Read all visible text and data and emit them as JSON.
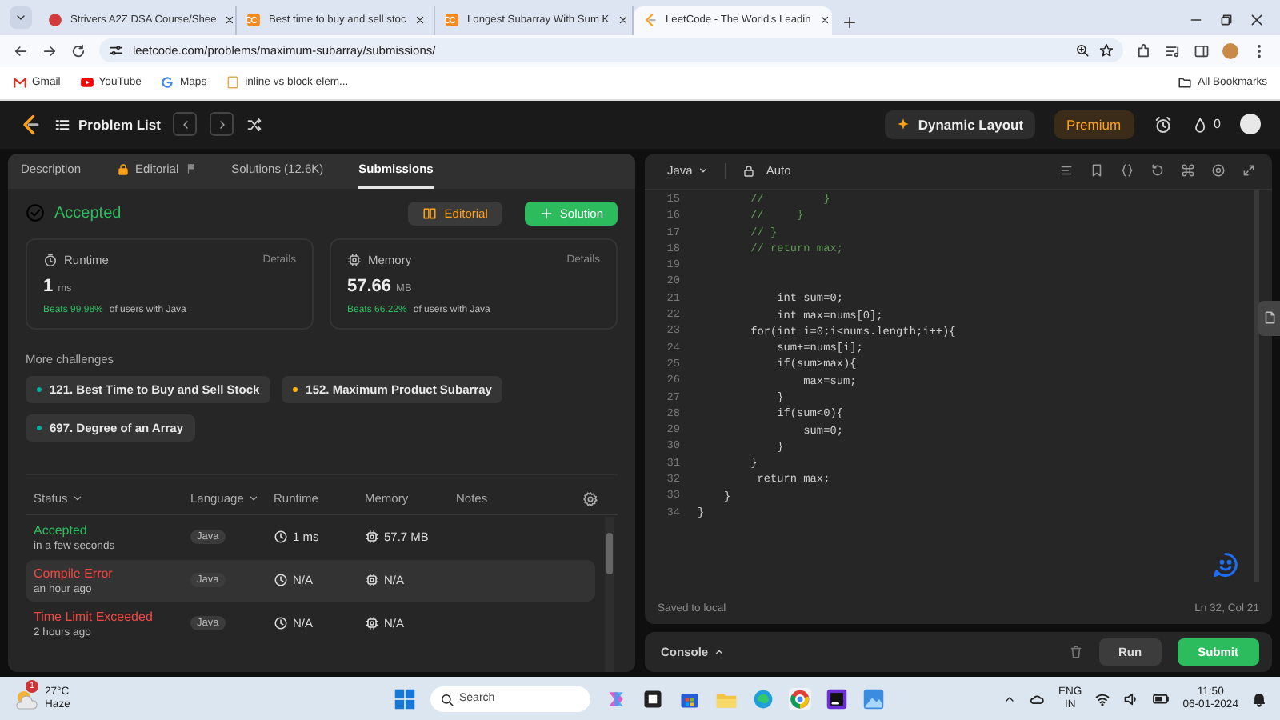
{
  "browser": {
    "tabs": [
      {
        "title": "Strivers A2Z DSA Course/Shee",
        "kind": "tuf",
        "selected": false
      },
      {
        "title": "Best time to buy and sell stoc",
        "kind": "ninjas",
        "selected": false
      },
      {
        "title": "Longest Subarray With Sum K",
        "kind": "ninjas",
        "selected": false
      },
      {
        "title": "LeetCode - The World's Leadin",
        "kind": "leetcode",
        "selected": true
      }
    ],
    "address": "leetcode.com/problems/maximum-subarray/submissions/",
    "bookmarks": [
      {
        "label": "Gmail",
        "kind": "gmail"
      },
      {
        "label": "YouTube",
        "kind": "youtube"
      },
      {
        "label": "Maps",
        "kind": "maps"
      },
      {
        "label": "inline vs block elem...",
        "kind": "page"
      }
    ],
    "all_bookmarks": "All Bookmarks"
  },
  "nav": {
    "problem_list": "Problem List",
    "dynamic_layout": "Dynamic Layout",
    "premium": "Premium",
    "streak": "0"
  },
  "left": {
    "tabs": [
      {
        "label": "Description",
        "selected": false,
        "locked": false
      },
      {
        "label": "Editorial",
        "selected": false,
        "locked": true
      },
      {
        "label": "Solutions (12.6K)",
        "selected": false,
        "locked": false
      },
      {
        "label": "Submissions",
        "selected": true,
        "locked": false
      }
    ],
    "result": {
      "status": "Accepted",
      "editorial_button": "Editorial",
      "solution_button": "Solution"
    },
    "metrics": [
      {
        "label": "Runtime",
        "kind": "runtime",
        "details": "Details",
        "value": "1",
        "unit": "ms",
        "beats": "Beats 99.98%",
        "suffix": "of users with Java"
      },
      {
        "label": "Memory",
        "kind": "memory",
        "details": "Details",
        "value": "57.66",
        "unit": "MB",
        "beats": "Beats 66.22%",
        "suffix": "of users with Java"
      }
    ],
    "more_challenges": {
      "title": "More challenges",
      "items": [
        {
          "label": "121. Best Time to Buy and Sell Stock",
          "color": "#00af9b"
        },
        {
          "label": "152. Maximum Product Subarray",
          "color": "#ffb800"
        },
        {
          "label": "697. Degree of an Array",
          "color": "#00af9b"
        }
      ]
    },
    "submissions": {
      "columns": [
        {
          "label": "Status",
          "dropdown": true
        },
        {
          "label": "Language",
          "dropdown": true
        },
        {
          "label": "Runtime",
          "dropdown": false
        },
        {
          "label": "Memory",
          "dropdown": false
        },
        {
          "label": "Notes",
          "dropdown": false
        }
      ],
      "rows": [
        {
          "status": "Accepted",
          "kind": "accepted",
          "time": "in a few seconds",
          "language": "Java",
          "runtime": "1 ms",
          "memory": "57.7 MB",
          "selected": false
        },
        {
          "status": "Compile Error",
          "kind": "error",
          "time": "an hour ago",
          "language": "Java",
          "runtime": "N/A",
          "memory": "N/A",
          "selected": true
        },
        {
          "status": "Time Limit Exceeded",
          "kind": "error",
          "time": "2 hours ago",
          "language": "Java",
          "runtime": "N/A",
          "memory": "N/A",
          "selected": false
        }
      ]
    }
  },
  "editor": {
    "language": "Java",
    "mode": "Auto",
    "lines": [
      {
        "num": "15",
        "kind": "comment",
        "text": "        //         }"
      },
      {
        "num": "16",
        "kind": "comment",
        "text": "        //     }"
      },
      {
        "num": "17",
        "kind": "comment",
        "text": "        // }"
      },
      {
        "num": "18",
        "kind": "comment",
        "text": "        // return max;"
      },
      {
        "num": "19"
      },
      {
        "num": "20"
      },
      {
        "num": "21",
        "kind": "code",
        "text": "            int sum=0;"
      },
      {
        "num": "22",
        "kind": "code",
        "text": "            int max=nums[0];"
      },
      {
        "num": "23",
        "kind": "code",
        "text": "        for(int i=0;i<nums.length;i++){"
      },
      {
        "num": "24",
        "kind": "code",
        "text": "            sum+=nums[i];"
      },
      {
        "num": "25",
        "kind": "code",
        "text": "            if(sum>max){"
      },
      {
        "num": "26",
        "kind": "code",
        "text": "                max=sum;"
      },
      {
        "num": "27",
        "kind": "code",
        "text": "            }"
      },
      {
        "num": "28",
        "kind": "code",
        "text": "            if(sum<0){"
      },
      {
        "num": "29",
        "kind": "code",
        "text": "                sum=0;"
      },
      {
        "num": "30",
        "kind": "code",
        "text": "            }"
      },
      {
        "num": "31",
        "kind": "code",
        "text": "        }"
      },
      {
        "num": "32",
        "kind": "code",
        "text": "         return max;"
      },
      {
        "num": "33",
        "kind": "code",
        "text": "    }"
      },
      {
        "num": "34",
        "kind": "code",
        "text": "}"
      }
    ],
    "status": "Saved to local",
    "cursor": "Ln 32, Col 21"
  },
  "console": {
    "label": "Console",
    "run": "Run",
    "submit": "Submit"
  },
  "taskbar": {
    "weather": {
      "temp": "27°C",
      "condition": "Haze",
      "badge": "1"
    },
    "search": {
      "placeholder": "Search"
    },
    "lang": "ENG",
    "region": "IN",
    "time": "11:50",
    "date": "06-01-2024"
  }
}
